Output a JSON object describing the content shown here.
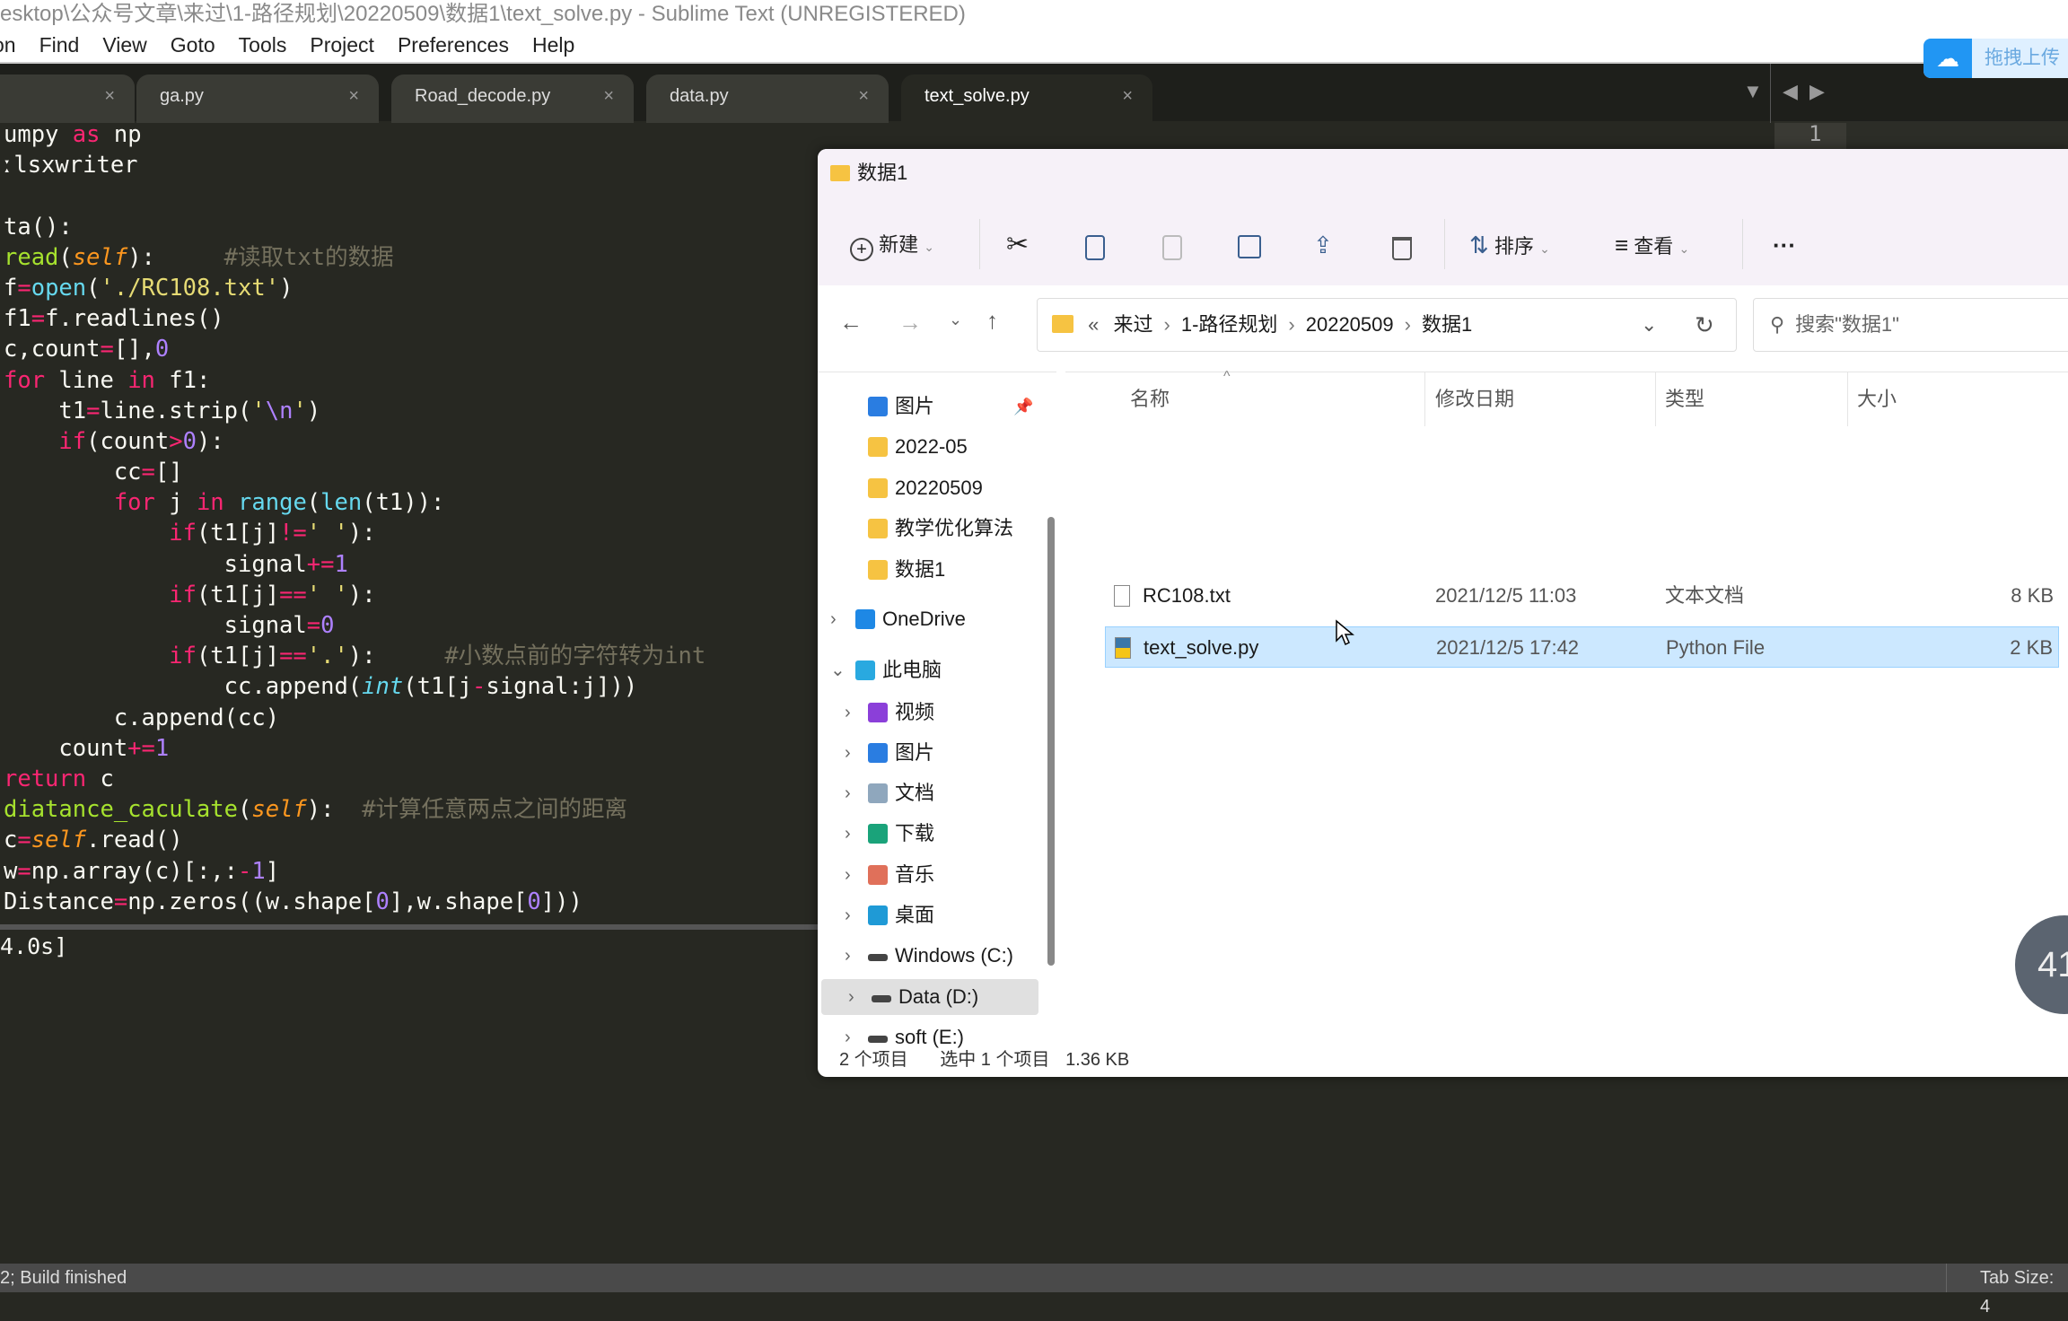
{
  "window": {
    "title": "esktop\\公众号文章\\来过\\1-路径规划\\20220509\\数据1\\text_solve.py - Sublime Text (UNREGISTERED)"
  },
  "menu": [
    "on",
    "Find",
    "View",
    "Goto",
    "Tools",
    "Project",
    "Preferences",
    "Help"
  ],
  "tabs": [
    {
      "label": ""
    },
    {
      "label": "ga.py"
    },
    {
      "label": "Road_decode.py"
    },
    {
      "label": "data.py"
    },
    {
      "label": "text_solve.py",
      "active": true
    }
  ],
  "tab_close": "×",
  "tab_nav": {
    "dropdown": "▼",
    "prev": "◀",
    "next": "▶"
  },
  "minimap_line": "1",
  "code": [
    [
      [
        "",
        "umpy "
      ],
      [
        "kw",
        "as"
      ],
      [
        "",
        " np"
      ]
    ],
    [
      [
        "",
        "ːlsxwriter"
      ]
    ],
    [],
    [
      [
        "",
        "ta():"
      ]
    ],
    [
      [
        "fn",
        "read"
      ],
      [
        "",
        "("
      ],
      [
        "self",
        "self"
      ],
      [
        "",
        "):     "
      ],
      [
        "cm",
        "#读取txt的数据"
      ]
    ],
    [
      [
        "",
        "f"
      ],
      [
        "kw",
        "="
      ],
      [
        "cy",
        "open"
      ],
      [
        "",
        "("
      ],
      [
        "st",
        "'./RC108.txt'"
      ],
      [
        "",
        ")"
      ]
    ],
    [
      [
        "",
        "f1"
      ],
      [
        "kw",
        "="
      ],
      [
        "",
        "f.readlines()"
      ]
    ],
    [
      [
        "",
        "c,count"
      ],
      [
        "kw",
        "="
      ],
      [
        "",
        "[],"
      ],
      [
        "pu",
        "0"
      ]
    ],
    [
      [
        "kw",
        "for"
      ],
      [
        "",
        " line "
      ],
      [
        "kw",
        "in"
      ],
      [
        "",
        " f1:"
      ]
    ],
    [
      [
        "",
        "    t1"
      ],
      [
        "kw",
        "="
      ],
      [
        "",
        "line.strip("
      ],
      [
        "st",
        "'"
      ],
      [
        "pu",
        "\\n"
      ],
      [
        "st",
        "'"
      ],
      [
        "",
        ")"
      ]
    ],
    [
      [
        "",
        "    "
      ],
      [
        "kw",
        "if"
      ],
      [
        "",
        "(count"
      ],
      [
        "kw",
        ">"
      ],
      [
        "pu",
        "0"
      ],
      [
        "",
        "):"
      ]
    ],
    [
      [
        "",
        "        cc"
      ],
      [
        "kw",
        "="
      ],
      [
        "",
        "[]"
      ]
    ],
    [
      [
        "",
        "        "
      ],
      [
        "kw",
        "for"
      ],
      [
        "",
        " j "
      ],
      [
        "kw",
        "in"
      ],
      [
        "",
        " "
      ],
      [
        "cy",
        "range"
      ],
      [
        "",
        "("
      ],
      [
        "cy",
        "len"
      ],
      [
        "",
        "(t1)):"
      ]
    ],
    [
      [
        "",
        "            "
      ],
      [
        "kw",
        "if"
      ],
      [
        "",
        "(t1[j]"
      ],
      [
        "kw",
        "!="
      ],
      [
        "st",
        "' '"
      ],
      [
        "",
        "):"
      ]
    ],
    [
      [
        "",
        "                signal"
      ],
      [
        "kw",
        "+="
      ],
      [
        "pu",
        "1"
      ]
    ],
    [
      [
        "",
        "            "
      ],
      [
        "kw",
        "if"
      ],
      [
        "",
        "(t1[j]"
      ],
      [
        "kw",
        "=="
      ],
      [
        "st",
        "' '"
      ],
      [
        "",
        "):"
      ]
    ],
    [
      [
        "",
        "                signal"
      ],
      [
        "kw",
        "="
      ],
      [
        "pu",
        "0"
      ]
    ],
    [
      [
        "",
        "            "
      ],
      [
        "kw",
        "if"
      ],
      [
        "",
        "(t1[j]"
      ],
      [
        "kw",
        "=="
      ],
      [
        "st",
        "'.'"
      ],
      [
        "",
        "):     "
      ],
      [
        "cm",
        "#小数点前的字符转为int"
      ]
    ],
    [
      [
        "",
        "                cc.append("
      ],
      [
        "cyi",
        "int"
      ],
      [
        "",
        "(t1[j"
      ],
      [
        "kw",
        "-"
      ],
      [
        "",
        "signal:j]))"
      ]
    ],
    [
      [
        "",
        "        c.append(cc)"
      ]
    ],
    [
      [
        "",
        "    count"
      ],
      [
        "kw",
        "+="
      ],
      [
        "pu",
        "1"
      ]
    ],
    [
      [
        "kw",
        "return"
      ],
      [
        "",
        " c"
      ]
    ],
    [
      [
        "fn",
        "diatance_caculate"
      ],
      [
        "",
        "("
      ],
      [
        "self",
        "self"
      ],
      [
        "",
        "):  "
      ],
      [
        "cm",
        "#计算任意两点之间的距离"
      ]
    ],
    [
      [
        "",
        "c"
      ],
      [
        "kw",
        "="
      ],
      [
        "self",
        "self"
      ],
      [
        "",
        ".read()"
      ]
    ],
    [
      [
        "",
        "w"
      ],
      [
        "kw",
        "="
      ],
      [
        "",
        "np.array(c)[:,:"
      ],
      [
        "kw",
        "-"
      ],
      [
        "pu",
        "1"
      ],
      [
        "",
        "]"
      ]
    ],
    [
      [
        "",
        "Distance"
      ],
      [
        "kw",
        "="
      ],
      [
        "",
        "np.zeros((w.shape["
      ],
      [
        "pu",
        "0"
      ],
      [
        "",
        "],w.shape["
      ],
      [
        "pu",
        "0"
      ],
      [
        "",
        "]))"
      ]
    ]
  ],
  "output": {
    "text": "4.0s]"
  },
  "statusbar": {
    "left": "2; Build finished",
    "right": "Tab Size: 4"
  },
  "explorer": {
    "title": "数据1",
    "toolbar": {
      "new": "新建",
      "sort": "排序",
      "view": "查看",
      "more": "···"
    },
    "address": {
      "overflow": "«",
      "crumbs": [
        "来过",
        "1-路径规划",
        "20220509",
        "数据1"
      ]
    },
    "search_placeholder": "搜索\"数据1\"",
    "nav": [
      {
        "label": "图片",
        "icon": "pictures-icon",
        "level": 1,
        "pinned": true
      },
      {
        "label": "2022-05",
        "icon": "folder-icon",
        "level": 1
      },
      {
        "label": "20220509",
        "icon": "folder-icon",
        "level": 1
      },
      {
        "label": "教学优化算法",
        "icon": "folder-icon",
        "level": 1
      },
      {
        "label": "数据1",
        "icon": "folder-icon",
        "level": 1
      },
      {
        "label": "OneDrive",
        "icon": "onedrive-icon",
        "level": 0,
        "chev": "›"
      },
      {
        "label": "此电脑",
        "icon": "this-pc-icon",
        "level": 0,
        "chev": "⌄"
      },
      {
        "label": "视频",
        "icon": "videos-icon",
        "level": 1,
        "chev": "›"
      },
      {
        "label": "图片",
        "icon": "pictures-icon",
        "level": 1,
        "chev": "›"
      },
      {
        "label": "文档",
        "icon": "documents-icon",
        "level": 1,
        "chev": "›"
      },
      {
        "label": "下载",
        "icon": "downloads-icon",
        "level": 1,
        "chev": "›"
      },
      {
        "label": "音乐",
        "icon": "music-icon",
        "level": 1,
        "chev": "›"
      },
      {
        "label": "桌面",
        "icon": "desktop-icon",
        "level": 1,
        "chev": "›"
      },
      {
        "label": "Windows (C:)",
        "icon": "drive-icon",
        "level": 1,
        "chev": "›"
      },
      {
        "label": "Data (D:)",
        "icon": "drive-icon",
        "level": 1,
        "chev": "›",
        "selected": true
      },
      {
        "label": "soft (E:)",
        "icon": "drive-icon",
        "level": 1,
        "chev": "›"
      }
    ],
    "columns": [
      "名称",
      "修改日期",
      "类型",
      "大小"
    ],
    "files": [
      {
        "name": "RC108.txt",
        "date": "2021/12/5 11:03",
        "type": "文本文档",
        "size": "8 KB",
        "icon": "text-file-icon"
      },
      {
        "name": "text_solve.py",
        "date": "2021/12/5 17:42",
        "type": "Python File",
        "size": "2 KB",
        "icon": "python-file-icon",
        "selected": true
      }
    ],
    "status": {
      "count": "2 个项目",
      "selected": "选中 1 个项目",
      "size": "1.36 KB"
    }
  },
  "baidu": {
    "label": "拖拽上传"
  },
  "badge": "41",
  "colors": {
    "editor_bg": "#272822",
    "keyword": "#f92672",
    "selection": "#cce8ff",
    "baidu": "#2196f3"
  }
}
